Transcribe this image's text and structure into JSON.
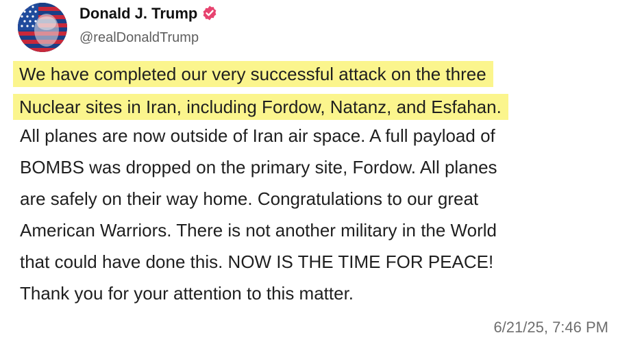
{
  "author": {
    "display_name": "Donald J. Trump",
    "handle": "@realDonaldTrump",
    "verified_badge_color": "#e7436f"
  },
  "post": {
    "highlight_color": "#fbf58d",
    "highlighted_lines": [
      "We have completed our very successful attack on the three",
      "Nuclear sites in Iran, including Fordow, Natanz, and Esfahan."
    ],
    "lines": [
      "All planes are now outside of Iran air space. A full payload of",
      "BOMBS was dropped on the primary site, Fordow. All planes",
      "are safely on their way home. Congratulations to our great",
      "American Warriors. There is not another military in the World",
      "that could have done this. NOW IS THE TIME FOR PEACE!",
      "Thank you for your attention to this matter."
    ],
    "timestamp": "6/21/25, 7:46 PM"
  },
  "icons": {
    "avatar": "profile-avatar-flag",
    "verified": "verified-badge-icon"
  }
}
